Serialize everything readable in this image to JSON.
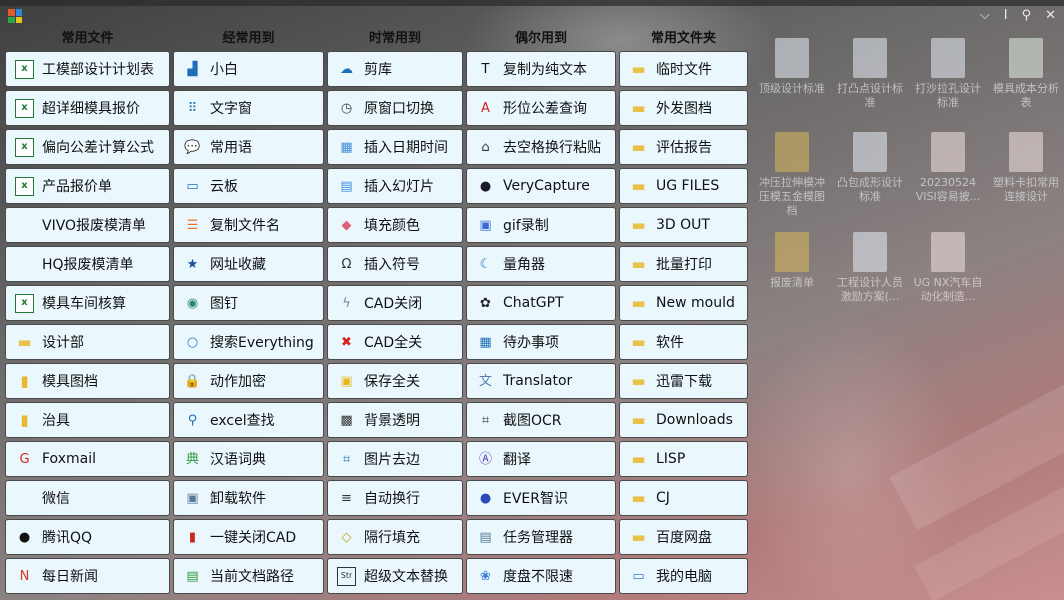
{
  "titlebar": {
    "controls": [
      "⌵",
      "Ⅰ",
      "⚲",
      "✕"
    ]
  },
  "columns": [
    {
      "header": "常用文件",
      "items": [
        {
          "label": "工模部设计计划表",
          "icon": "excel-file-icon",
          "glyph": "x",
          "color": "#1f7a3a"
        },
        {
          "label": "超详细模具报价",
          "icon": "excel-file-icon",
          "glyph": "x",
          "color": "#1f7a3a"
        },
        {
          "label": "偏向公差计算公式",
          "icon": "excel-file-icon",
          "glyph": "x",
          "color": "#1f7a3a"
        },
        {
          "label": "产品报价单",
          "icon": "excel-file-icon",
          "glyph": "x",
          "color": "#1f7a3a"
        },
        {
          "label": "VIVO报废模清单",
          "icon": "",
          "glyph": "",
          "color": ""
        },
        {
          "label": "HQ报废模清单",
          "icon": "",
          "glyph": "",
          "color": ""
        },
        {
          "label": "模具车间核算",
          "icon": "excel-file-icon",
          "glyph": "x",
          "color": "#1f7a3a"
        },
        {
          "label": "设计部",
          "icon": "folder-icon",
          "glyph": "▬",
          "color": "#e8c24a"
        },
        {
          "label": "模具图档",
          "icon": "folder-icon",
          "glyph": "▮",
          "color": "#e8b830"
        },
        {
          "label": "治具",
          "icon": "folder-icon",
          "glyph": "▮",
          "color": "#e8b830"
        },
        {
          "label": "Foxmail",
          "icon": "foxmail-icon",
          "glyph": "G",
          "color": "#d3231e"
        },
        {
          "label": "微信",
          "icon": "",
          "glyph": "",
          "color": ""
        },
        {
          "label": "腾讯QQ",
          "icon": "qq-penguin-icon",
          "glyph": "●",
          "color": "#111111"
        },
        {
          "label": "每日新闻",
          "icon": "news-icon",
          "glyph": "N",
          "color": "#d8342a"
        }
      ]
    },
    {
      "header": "经常用到",
      "items": [
        {
          "label": "小白",
          "icon": "puppy-icon",
          "glyph": "▟",
          "color": "#1d6fb8"
        },
        {
          "label": "文字窗",
          "icon": "grid-dots-icon",
          "glyph": "⠿",
          "color": "#1d6fb8"
        },
        {
          "label": "常用语",
          "icon": "chat-bubble-icon",
          "glyph": "💬",
          "color": "#444444"
        },
        {
          "label": "云板",
          "icon": "laptop-icon",
          "glyph": "▭",
          "color": "#1d6fb8"
        },
        {
          "label": "复制文件名",
          "icon": "document-list-icon",
          "glyph": "☰",
          "color": "#e8722a"
        },
        {
          "label": "网址收藏",
          "icon": "bookmark-star-icon",
          "glyph": "★",
          "color": "#1d4f9a"
        },
        {
          "label": "图钉",
          "icon": "globe-icon",
          "glyph": "◉",
          "color": "#2a8a6a"
        },
        {
          "label": "搜索Everything",
          "icon": "search-icon",
          "glyph": "○",
          "color": "#2a7ac8"
        },
        {
          "label": "动作加密",
          "icon": "lock-icon",
          "glyph": "🔒",
          "color": "#222222"
        },
        {
          "label": "excel查找",
          "icon": "magnifier-icon",
          "glyph": "⚲",
          "color": "#1d6fb8"
        },
        {
          "label": "汉语词典",
          "icon": "dictionary-icon",
          "glyph": "典",
          "color": "#2a9a3a"
        },
        {
          "label": "卸载软件",
          "icon": "uninstall-icon",
          "glyph": "▣",
          "color": "#5a7a9a"
        },
        {
          "label": "一键关闭CAD",
          "icon": "close-cad-icon",
          "glyph": "▮",
          "color": "#c8281e"
        },
        {
          "label": "当前文档路径",
          "icon": "document-search-icon",
          "glyph": "▤",
          "color": "#2a9a3a"
        }
      ]
    },
    {
      "header": "时常用到",
      "items": [
        {
          "label": "剪库",
          "icon": "cloud-drive-icon",
          "glyph": "☁",
          "color": "#1d6fb8"
        },
        {
          "label": "原窗口切换",
          "icon": "clock-icon",
          "glyph": "◷",
          "color": "#444444"
        },
        {
          "label": "插入日期时间",
          "icon": "calendar-icon",
          "glyph": "▦",
          "color": "#3a8ad8"
        },
        {
          "label": "插入幻灯片",
          "icon": "slide-icon",
          "glyph": "▤",
          "color": "#3a8ad8"
        },
        {
          "label": "填充颜色",
          "icon": "paint-bucket-icon",
          "glyph": "◆",
          "color": "#e0607a"
        },
        {
          "label": "插入符号",
          "icon": "omega-symbol-icon",
          "glyph": "Ω",
          "color": "#333333"
        },
        {
          "label": "CAD关闭",
          "icon": "lightning-icon",
          "glyph": "ϟ",
          "color": "#7a8aa8"
        },
        {
          "label": "CAD全关",
          "icon": "close-all-icon",
          "glyph": "✖",
          "color": "#d3231e"
        },
        {
          "label": "保存全关",
          "icon": "save-close-icon",
          "glyph": "▣",
          "color": "#e8b820"
        },
        {
          "label": "背景透明",
          "icon": "checkerboard-icon",
          "glyph": "▩",
          "color": "#333333"
        },
        {
          "label": "图片去边",
          "icon": "crop-icon",
          "glyph": "⌗",
          "color": "#1d6fb8"
        },
        {
          "label": "自动换行",
          "icon": "wrap-text-icon",
          "glyph": "≡",
          "color": "#333333"
        },
        {
          "label": "隔行填充",
          "icon": "fill-rows-icon",
          "glyph": "◇",
          "color": "#caa020"
        },
        {
          "label": "超级文本替换",
          "icon": "str-replace-icon",
          "glyph": "Str",
          "color": "#333333"
        }
      ]
    },
    {
      "header": "偶尔用到",
      "items": [
        {
          "label": "复制为纯文本",
          "icon": "plain-text-icon",
          "glyph": "T",
          "color": "#111111"
        },
        {
          "label": "形位公差查询",
          "icon": "tolerance-a-icon",
          "glyph": "A",
          "color": "#d3231e"
        },
        {
          "label": "去空格换行粘贴",
          "icon": "paste-format-icon",
          "glyph": "⌂",
          "color": "#333333"
        },
        {
          "label": "VeryCapture",
          "icon": "panda-icon",
          "glyph": "●",
          "color": "#1a1a2a"
        },
        {
          "label": "gif录制",
          "icon": "gif-record-icon",
          "glyph": "▣",
          "color": "#3a6ad8"
        },
        {
          "label": "量角器",
          "icon": "moon-protractor-icon",
          "glyph": "☾",
          "color": "#1d6fb8"
        },
        {
          "label": "ChatGPT",
          "icon": "chatgpt-icon",
          "glyph": "✿",
          "color": "#222222"
        },
        {
          "label": "待办事项",
          "icon": "calendar-todo-icon",
          "glyph": "▦",
          "color": "#1d6fb8"
        },
        {
          "label": "Translator",
          "icon": "translator-icon",
          "glyph": "文",
          "color": "#5a7ab8"
        },
        {
          "label": "截图OCR",
          "icon": "ocr-scan-icon",
          "glyph": "⌗",
          "color": "#333333"
        },
        {
          "label": "翻译",
          "icon": "translate-a-icon",
          "glyph": "Ⓐ",
          "color": "#5a3ab8"
        },
        {
          "label": "EVER智识",
          "icon": "ever-icon",
          "glyph": "●",
          "color": "#2a4ab8"
        },
        {
          "label": "任务管理器",
          "icon": "task-manager-icon",
          "glyph": "▤",
          "color": "#5a7a9a"
        },
        {
          "label": "度盘不限速",
          "icon": "cloud-speed-icon",
          "glyph": "❀",
          "color": "#3a7ad8"
        }
      ]
    },
    {
      "header": "常用文件夹",
      "items": [
        {
          "label": "临时文件",
          "icon": "folder-icon",
          "glyph": "▬",
          "color": "#e8c24a"
        },
        {
          "label": "外发图档",
          "icon": "folder-icon",
          "glyph": "▬",
          "color": "#e8c24a"
        },
        {
          "label": "评估报告",
          "icon": "folder-icon",
          "glyph": "▬",
          "color": "#e8c24a"
        },
        {
          "label": "UG FILES",
          "icon": "folder-icon",
          "glyph": "▬",
          "color": "#e8c24a"
        },
        {
          "label": "3D OUT",
          "icon": "folder-icon",
          "glyph": "▬",
          "color": "#e8c24a"
        },
        {
          "label": "批量打印",
          "icon": "folder-icon",
          "glyph": "▬",
          "color": "#e8c24a"
        },
        {
          "label": "New mould",
          "icon": "folder-icon",
          "glyph": "▬",
          "color": "#e8c24a"
        },
        {
          "label": "软件",
          "icon": "folder-icon",
          "glyph": "▬",
          "color": "#e8c24a"
        },
        {
          "label": "迅雷下载",
          "icon": "folder-icon",
          "glyph": "▬",
          "color": "#e8c24a"
        },
        {
          "label": "Downloads",
          "icon": "folder-icon",
          "glyph": "▬",
          "color": "#e8c24a"
        },
        {
          "label": "LISP",
          "icon": "folder-icon",
          "glyph": "▬",
          "color": "#e8c24a"
        },
        {
          "label": "CJ",
          "icon": "folder-icon",
          "glyph": "▬",
          "color": "#e8c24a"
        },
        {
          "label": "百度网盘",
          "icon": "folder-icon",
          "glyph": "▬",
          "color": "#e8c24a"
        },
        {
          "label": "我的电脑",
          "icon": "computer-icon",
          "glyph": "▭",
          "color": "#3a7ac8"
        }
      ]
    }
  ],
  "desktop_icons": [
    {
      "label": "顶级设计标准",
      "kind": "word-doc-icon"
    },
    {
      "label": "打凸点设计标准",
      "kind": "word-doc-icon"
    },
    {
      "label": "打沙拉孔设计标准",
      "kind": "word-doc-icon"
    },
    {
      "label": "模具成本分析表",
      "kind": "excel-doc-icon"
    },
    {
      "label": "冲压拉伸模冲压模五金模图档",
      "kind": "folder-doc-icon"
    },
    {
      "label": "凸包成形设计标准",
      "kind": "word-doc-icon"
    },
    {
      "label": "20230524 VISI容易披...",
      "kind": "pdf-doc-icon"
    },
    {
      "label": "塑料卡扣常用连接设计",
      "kind": "pdf-doc-icon"
    },
    {
      "label": "报废清单",
      "kind": "folder-doc-icon"
    },
    {
      "label": "工程设计人员激励方案(...",
      "kind": "word-doc-icon"
    },
    {
      "label": "UG NX汽车自动化制造...",
      "kind": "pdf-doc-icon"
    }
  ]
}
